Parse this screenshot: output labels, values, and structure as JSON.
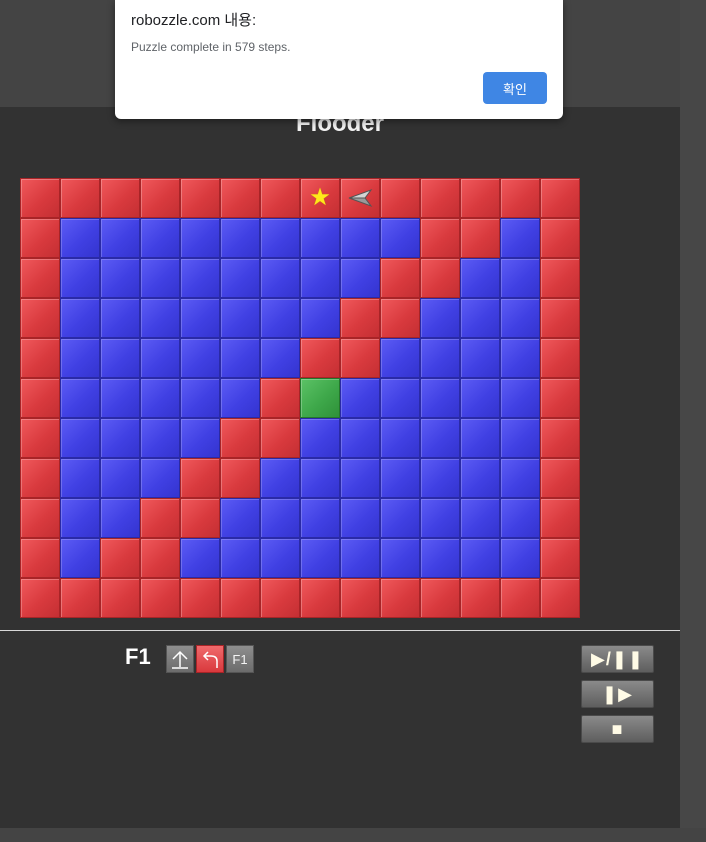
{
  "dialog": {
    "title": "robozzle.com 내용:",
    "message": "Puzzle complete in 579 steps.",
    "ok_label": "확인"
  },
  "puzzle": {
    "title": "Flooder",
    "grid": [
      "RRRRRRRRRRRRRR",
      "RBBBBBBBBBRRBR",
      "RBBBBBBBBRRBBR",
      "RBBBBBBBRRBBBR",
      "RBBBBBBRRBBBBR",
      "RBBBBBRGBBBBBR",
      "RBBBBRRBBBBBBR",
      "RBBBRRBBBBBBBR",
      "RBBRRBBBBBBBBR",
      "RBRRBBBBBBBBBR",
      "RRRRRRRRRRRRRR"
    ],
    "star_cells": [
      [
        0,
        7
      ]
    ],
    "robot": {
      "row": 0,
      "col": 8,
      "direction": "left"
    },
    "colors": {
      "R": "#dc3d41",
      "B": "#4545e6",
      "G": "#3ea84a"
    }
  },
  "program": {
    "function_label": "F1",
    "instructions": [
      {
        "icon": "forward-arrow-icon",
        "color": "gray",
        "text": ""
      },
      {
        "icon": "turn-left-icon",
        "color": "red",
        "text": ""
      },
      {
        "icon": "",
        "color": "gray",
        "text": "F1"
      }
    ]
  },
  "controls": {
    "play_pause_label": "▶/❚❚",
    "step_label": "❚▶",
    "stop_label": "■"
  }
}
